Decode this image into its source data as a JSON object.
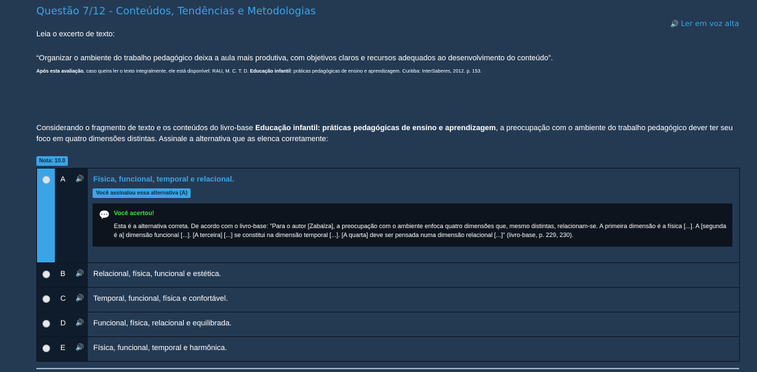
{
  "header": {
    "title": "Questão 7/12 - Conteúdos, Tendências e Metodologias",
    "read_aloud": "Ler em voz alta"
  },
  "excerpt": {
    "intro": "Leia o excerto de texto:",
    "quote": "“Organizar o ambiente do trabalho pedagógico deixa a aula mais produtiva, com objetivos claros e recursos adequados ao desenvolvimento do conteúdo”.",
    "source_lead": "Após esta avaliação",
    "source_mid": ", caso queira ler o texto integralmente, ele está disponível: RAU, M. C. T. D. ",
    "source_book": "Educação infantil",
    "source_tail": ": práticas pedagógicas de ensino e aprendizagem. Curitiba: InterSaberes, 2012. p. 153."
  },
  "question": {
    "part1": "Considerando o fragmento de texto e os conteúdos do livro-base ",
    "book": "Educação infantil: práticas pedagógicas de ensino e aprendizagem",
    "part2": ", a preocupação com o ambiente do trabalho pedagógico dever ter seu foco em quatro dimensões distintas. Assinale a alternativa que as elenca corretamente:"
  },
  "grade": "Nota: 10.0",
  "alternatives": [
    {
      "letter": "A",
      "text": "Física, funcional, temporal e relacional."
    },
    {
      "letter": "B",
      "text": "Relacional, física, funcional e estética."
    },
    {
      "letter": "C",
      "text": "Temporal, funcional, física e confortável."
    },
    {
      "letter": "D",
      "text": "Funcional, física, relacional e equilibrada."
    },
    {
      "letter": "E",
      "text": "Física, funcional, temporal e harmônica."
    }
  ],
  "selected": {
    "badge": "Você assinalou essa alternativa (A)"
  },
  "feedback": {
    "title": "Você acertou!",
    "text": "Esta é a alternativa correta. De acordo com o livro-base: \"Para o autor [Zabalza], a preocupação com o ambiente enfoca quatro dimensões que, mesmo distintas, relacionam-se. A primeira dimensão é a física [...]. A [segunda é a] dimensão funcional [...]. [A terceira] [...] se constitui na dimensão temporal [...]. [A quarta] deve ser pensada numa dimensão relacional [...]\" (livro-base, p. 229, 230)."
  },
  "colors": {
    "background": "#243a53",
    "accent": "#3aa4e6",
    "success": "#36e63b",
    "panel_dark": "#0d141d"
  },
  "icons": {
    "speaker": "speaker-icon",
    "comment": "comment-bubble-icon",
    "radio": "radio-icon"
  }
}
